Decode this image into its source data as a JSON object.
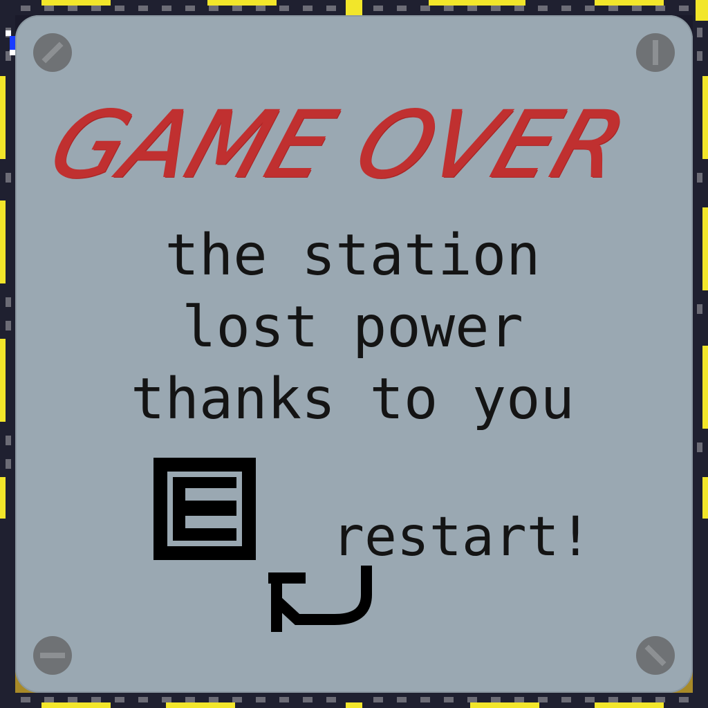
{
  "game_over": {
    "title": "GAME OVER",
    "message_lines": [
      "the station",
      "lost power",
      "thanks to you"
    ],
    "key_hint": "E",
    "restart_label": "restart!"
  },
  "colors": {
    "panel": "#9aa8b2",
    "title": "#c03030",
    "text": "#141414",
    "hazard_yellow": "#f2e62a",
    "hazard_dark": "#1f2030",
    "floor": "#a88a28",
    "screw": "#6f7275"
  },
  "icons": {
    "restart": "restart-arrow-icon",
    "key": "e-key-icon",
    "screws": "screw-icon"
  }
}
